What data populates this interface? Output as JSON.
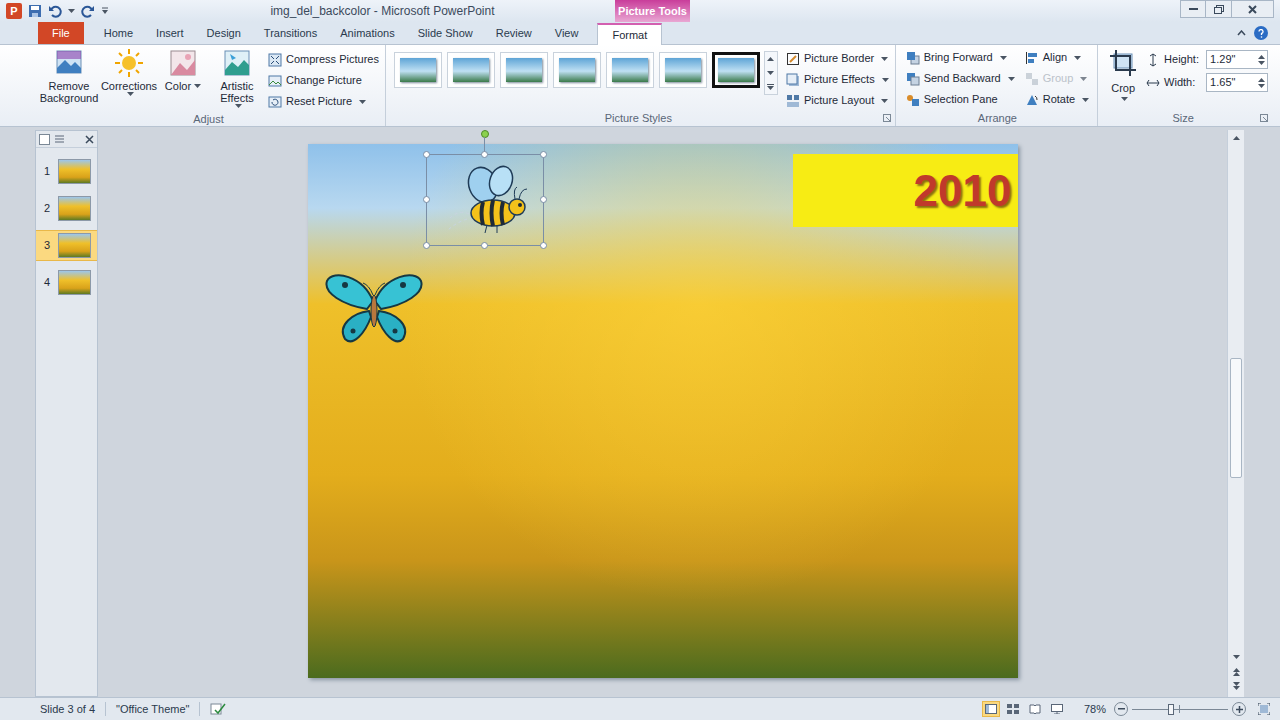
{
  "window": {
    "app_icon": "P",
    "title": "img_del_backcolor - Microsoft PowerPoint",
    "context_tab": "Picture Tools"
  },
  "tabs": [
    {
      "label": "File",
      "selected": false,
      "kind": "file"
    },
    {
      "label": "Home",
      "selected": false,
      "kind": "normal"
    },
    {
      "label": "Insert",
      "selected": false,
      "kind": "normal"
    },
    {
      "label": "Design",
      "selected": false,
      "kind": "normal"
    },
    {
      "label": "Transitions",
      "selected": false,
      "kind": "normal"
    },
    {
      "label": "Animations",
      "selected": false,
      "kind": "normal"
    },
    {
      "label": "Slide Show",
      "selected": false,
      "kind": "normal"
    },
    {
      "label": "Review",
      "selected": false,
      "kind": "normal"
    },
    {
      "label": "View",
      "selected": false,
      "kind": "normal"
    },
    {
      "label": "Format",
      "selected": true,
      "kind": "context"
    }
  ],
  "ribbon": {
    "adjust": {
      "label": "Adjust",
      "large": [
        {
          "label": "Remove Background",
          "dropdown": false
        },
        {
          "label": "Corrections",
          "dropdown": true
        },
        {
          "label": "Color",
          "dropdown": true
        },
        {
          "label": "Artistic Effects",
          "dropdown": true
        }
      ],
      "small": [
        {
          "label": "Compress Pictures",
          "dropdown": false
        },
        {
          "label": "Change Picture",
          "dropdown": false
        },
        {
          "label": "Reset Picture",
          "dropdown": true
        }
      ]
    },
    "picture_styles": {
      "label": "Picture Styles",
      "styles": [
        {
          "selected": false
        },
        {
          "selected": false
        },
        {
          "selected": false
        },
        {
          "selected": false
        },
        {
          "selected": false
        },
        {
          "selected": false
        },
        {
          "selected": true
        }
      ],
      "buttons": [
        {
          "label": "Picture Border",
          "dropdown": true
        },
        {
          "label": "Picture Effects",
          "dropdown": true
        },
        {
          "label": "Picture Layout",
          "dropdown": true
        }
      ]
    },
    "arrange": {
      "label": "Arrange",
      "buttons": [
        {
          "label": "Bring Forward",
          "dropdown": true,
          "disabled": false
        },
        {
          "label": "Send Backward",
          "dropdown": true,
          "disabled": false
        },
        {
          "label": "Selection Pane",
          "dropdown": false,
          "disabled": false
        },
        {
          "label": "Align",
          "dropdown": true,
          "disabled": false
        },
        {
          "label": "Group",
          "dropdown": true,
          "disabled": true
        },
        {
          "label": "Rotate",
          "dropdown": true,
          "disabled": false
        }
      ]
    },
    "size": {
      "label": "Size",
      "crop": {
        "label": "Crop",
        "dropdown": true
      },
      "fields": [
        {
          "label": "Height:",
          "value": "1.29\""
        },
        {
          "label": "Width:",
          "value": "1.65\""
        }
      ]
    }
  },
  "slides": [
    {
      "number": "1",
      "selected": false
    },
    {
      "number": "2",
      "selected": false
    },
    {
      "number": "3",
      "selected": true
    },
    {
      "number": "4",
      "selected": false
    }
  ],
  "slide": {
    "banner": "2010",
    "objects": [
      {
        "kind": "bee",
        "selected": true
      },
      {
        "kind": "butterfly",
        "selected": false
      }
    ]
  },
  "status_bar": {
    "slide": "Slide 3 of 4",
    "theme": "\"Office Theme\"",
    "zoom": "78%",
    "zoom_level": 0.4
  }
}
